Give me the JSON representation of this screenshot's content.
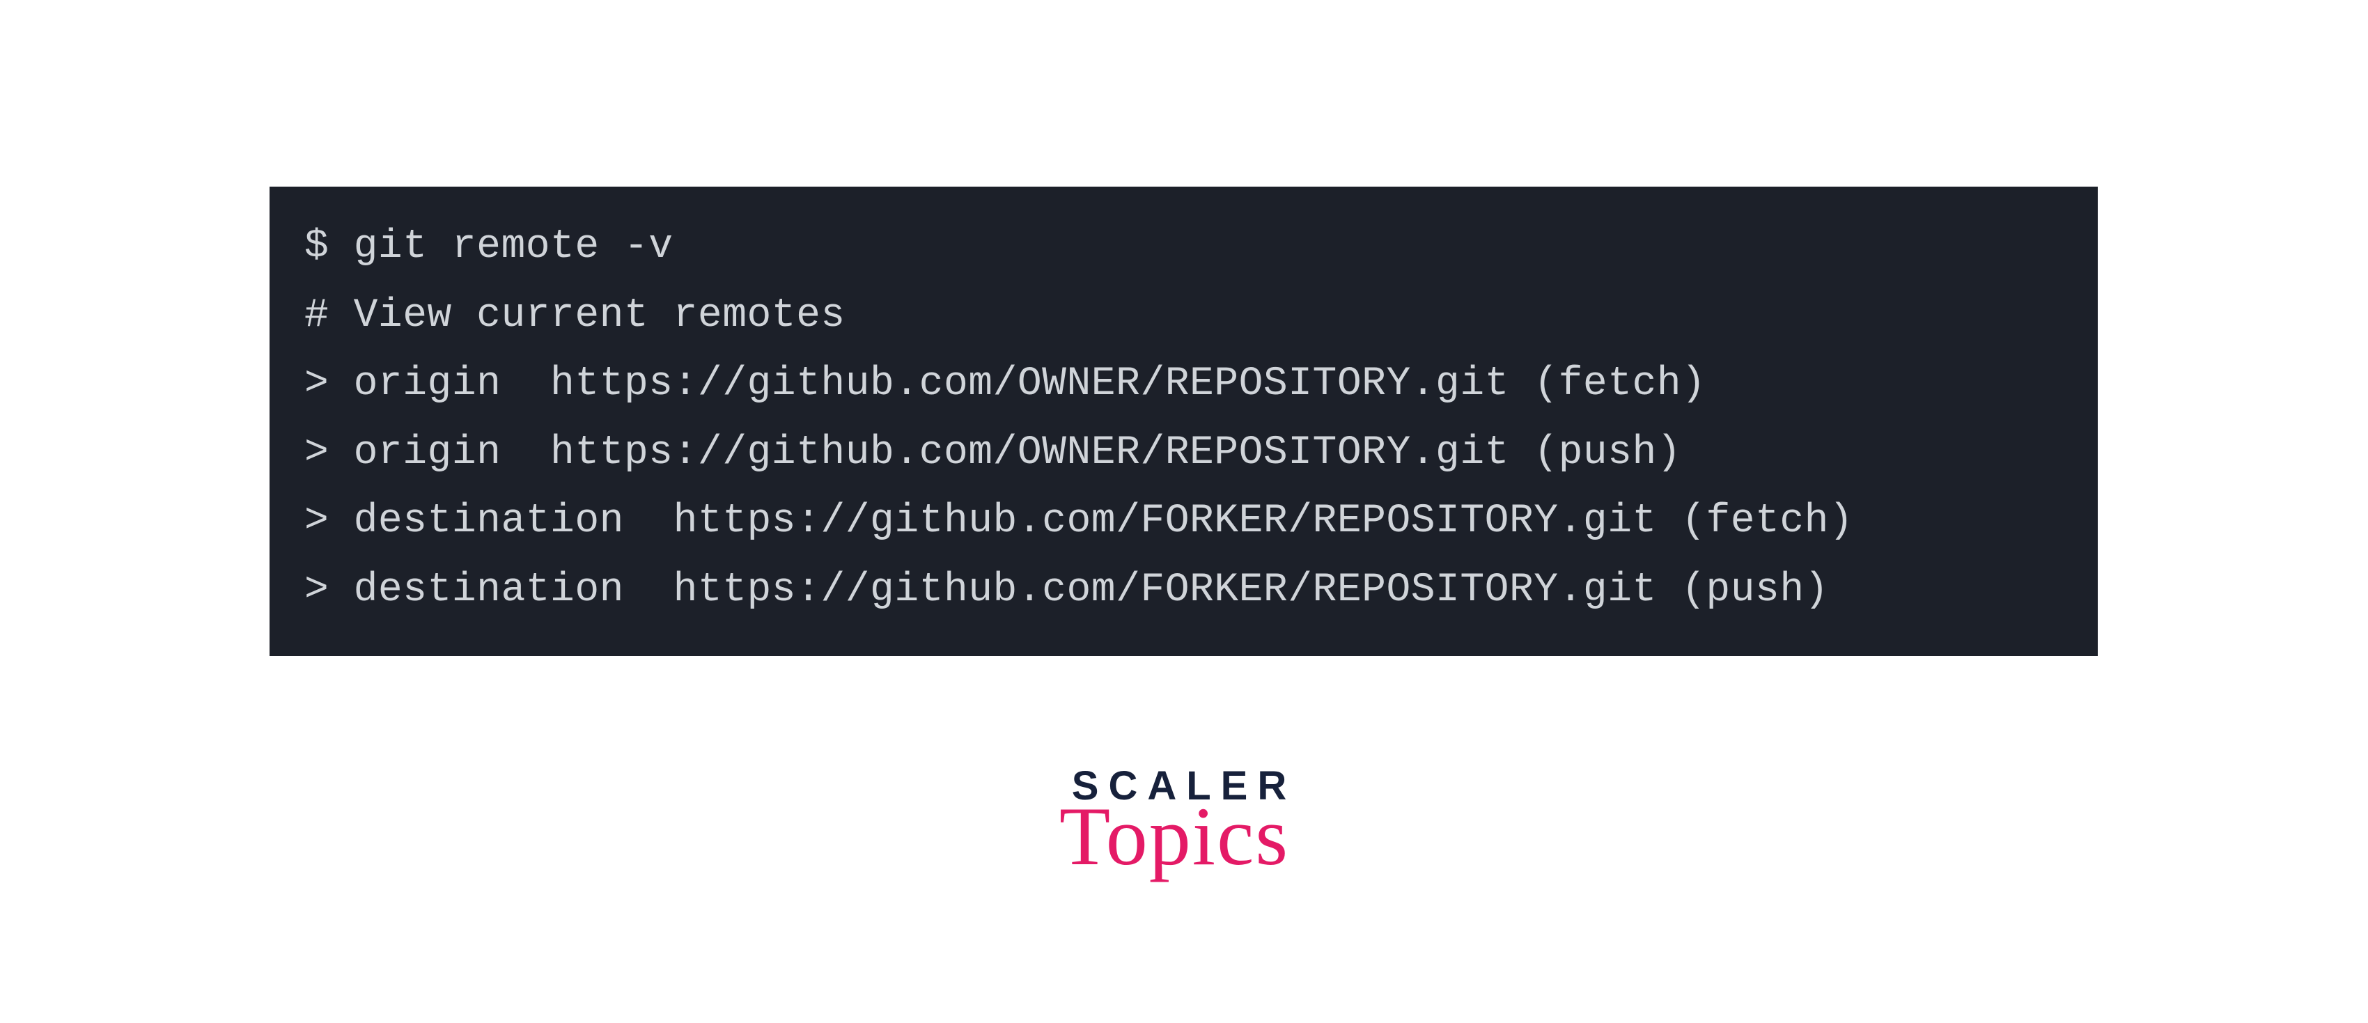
{
  "terminal": {
    "lines": [
      "$ git remote -v",
      "# View current remotes",
      "> origin  https://github.com/OWNER/REPOSITORY.git (fetch)",
      "> origin  https://github.com/OWNER/REPOSITORY.git (push)",
      "> destination  https://github.com/FORKER/REPOSITORY.git (fetch)",
      "> destination  https://github.com/FORKER/REPOSITORY.git (push)"
    ]
  },
  "logo": {
    "line1": "SCALER",
    "line2": "Topics"
  }
}
